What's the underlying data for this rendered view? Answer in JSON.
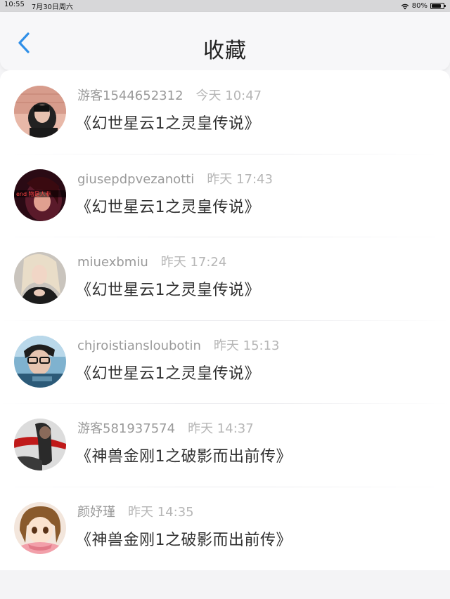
{
  "status_bar": {
    "time": "10:55",
    "date": "7月30日周六",
    "battery": "80%",
    "battery_level": 0.8
  },
  "nav": {
    "title": "收藏"
  },
  "items": [
    {
      "user": "游客1544652312",
      "time": "今天 10:47",
      "book": "《幻世星云1之灵皇传说》"
    },
    {
      "user": "giusepdpvezanotti",
      "time": "昨天 17:43",
      "book": "《幻世星云1之灵皇传说》",
      "avatar_text": "end 物是人非"
    },
    {
      "user": "miuexbmiu",
      "time": "昨天 17:24",
      "book": "《幻世星云1之灵皇传说》"
    },
    {
      "user": "chjroistiansloubotin",
      "time": "昨天 15:13",
      "book": "《幻世星云1之灵皇传说》"
    },
    {
      "user": "游客581937574",
      "time": "昨天 14:37",
      "book": "《神兽金刚1之破影而出前传》"
    },
    {
      "user": "颜妤瑾",
      "time": "昨天 14:35",
      "book": "《神兽金刚1之破影而出前传》"
    }
  ]
}
